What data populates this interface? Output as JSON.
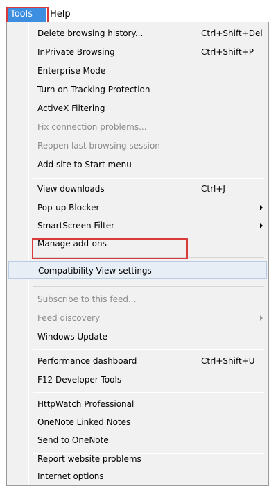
{
  "menubar": {
    "tools": "Tools",
    "help": "Help"
  },
  "menu": {
    "group1": [
      {
        "label": "Delete browsing history...",
        "shortcut": "Ctrl+Shift+Del"
      },
      {
        "label": "InPrivate Browsing",
        "shortcut": "Ctrl+Shift+P"
      },
      {
        "label": "Enterprise Mode"
      },
      {
        "label": "Turn on Tracking Protection"
      },
      {
        "label": "ActiveX Filtering"
      },
      {
        "label": "Fix connection problems..."
      },
      {
        "label": "Reopen last browsing session"
      },
      {
        "label": "Add site to Start menu"
      }
    ],
    "group2": [
      {
        "label": "View downloads",
        "shortcut": "Ctrl+J"
      },
      {
        "label": "Pop-up Blocker"
      },
      {
        "label": "SmartScreen Filter"
      },
      {
        "label": "Manage add-ons"
      }
    ],
    "group3": [
      {
        "label": "Compatibility View settings"
      }
    ],
    "group4": [
      {
        "label": "Subscribe to this feed..."
      },
      {
        "label": "Feed discovery"
      },
      {
        "label": "Windows Update"
      }
    ],
    "group5": [
      {
        "label": "Performance dashboard",
        "shortcut": "Ctrl+Shift+U"
      },
      {
        "label": "F12 Developer Tools"
      }
    ],
    "group6": [
      {
        "label": "HttpWatch Professional"
      },
      {
        "label": "OneNote Linked Notes"
      },
      {
        "label": "Send to OneNote"
      }
    ],
    "group7": [
      {
        "label": "Report website problems"
      },
      {
        "label": "Internet options"
      }
    ]
  },
  "colors": {
    "highlight_box": "#d93a3a",
    "menubar_active": "#3c8fe0",
    "selected_item": "#e8eef6"
  }
}
